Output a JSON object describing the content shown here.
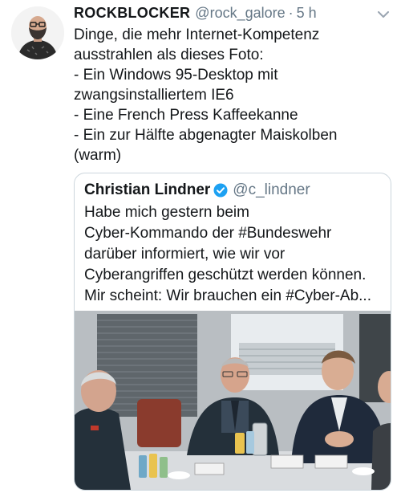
{
  "tweet": {
    "display_name": "ROCKBLOCKER",
    "handle": "@rock_galore",
    "separator": "·",
    "time": "5 h",
    "avatar_icon": "profile-photo",
    "menu_icon": "chevron-down-icon",
    "text_lines": [
      "Dinge, die mehr Internet-Kompetenz",
      "ausstrahlen als dieses Foto:",
      "- Ein Windows 95-Desktop mit",
      "zwangsinstalliertem IE6",
      "- Eine French Press Kaffeekanne",
      "- Ein zur Hälfte abgenagter Maiskolben",
      "(warm)"
    ]
  },
  "quoted_tweet": {
    "display_name": "Christian Lindner",
    "verified_icon": "verified-badge-icon",
    "handle": "@c_lindner",
    "text_lines": [
      "Habe mich gestern beim",
      "Cyber-Kommando der #Bundeswehr",
      "darüber informiert, wie wir vor",
      "Cyberangriffen geschützt werden können.",
      "Mir scheint: Wir brauchen ein #Cyber-Ab..."
    ],
    "photo_description_icon": "meeting-photo"
  },
  "colors": {
    "text": "#14171a",
    "secondary": "#657786",
    "border": "#ccd6dd",
    "verified": "#1da1f2"
  }
}
